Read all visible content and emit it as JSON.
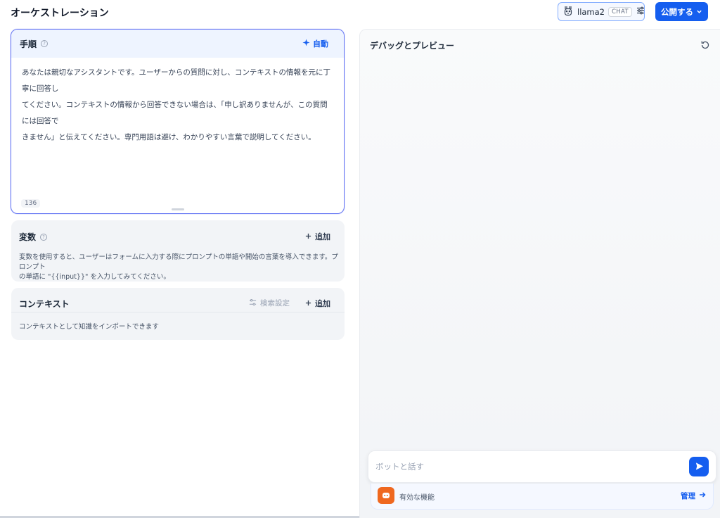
{
  "header": {
    "title": "オーケストレーション",
    "model": {
      "name": "llama2",
      "badge": "CHAT",
      "icon": "llama-icon",
      "settings_icon": "sliders-icon"
    },
    "publish_label": "公開する",
    "publish_icon": "chevron-down-icon"
  },
  "instructions": {
    "title": "手順",
    "help_icon": "help-circle-icon",
    "auto_label": "自動",
    "auto_icon": "sparkle-icon",
    "lines": [
      "あなたは親切なアシスタントです。ユーザーからの質問に対し、コンテキストの情報を元に丁寧に回答し",
      "てください。コンテキストの情報から回答できない場合は、「申し訳ありませんが、この質問には回答で",
      "きません」と伝えてください。専門用語は避け、わかりやすい言葉で説明してください。"
    ],
    "char_count": "136"
  },
  "variables": {
    "title": "変数",
    "help_icon": "help-circle-icon",
    "add_label": "追加",
    "description_lines": [
      "変数を使用すると、ユーザーはフォームに入力する際にプロンプトの単語や開始の言葉を導入できます。プロンプト",
      "の単語に \"{{input}}\" を入力してみてください。"
    ]
  },
  "context": {
    "title": "コンテキスト",
    "retrieval_label": "検索設定",
    "add_label": "追加",
    "description": "コンテキストとして知識をインポートできます"
  },
  "debug": {
    "title": "デバッグとプレビュー",
    "refresh_icon": "refresh-icon",
    "input_placeholder": "ボットと話す",
    "send_icon": "send-icon",
    "features_label": "有効な機能",
    "features_icon": "robot-face-icon",
    "manage_label": "管理",
    "manage_icon": "arrow-right-icon"
  },
  "colors": {
    "accent": "#155eef",
    "focus_border": "#6172f3",
    "feature_orange": "#ef6820"
  }
}
